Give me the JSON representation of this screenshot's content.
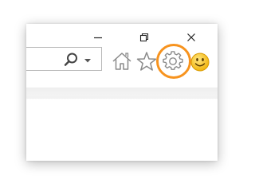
{
  "window_controls": {
    "minimize_icon": "minimize-icon",
    "maximize_icon": "restore-icon",
    "close_icon": "close-icon"
  },
  "toolbar": {
    "address_bar": {
      "value": "",
      "search_icon": "search-icon",
      "dropdown_icon": "chevron-down-icon"
    },
    "buttons": [
      {
        "name": "home",
        "icon": "home-icon"
      },
      {
        "name": "favorites",
        "icon": "star-icon"
      },
      {
        "name": "tools",
        "icon": "gear-icon",
        "highlighted": true
      },
      {
        "name": "feedback",
        "icon": "smiley-icon"
      }
    ]
  },
  "colors": {
    "highlight_ring": "#f7931e",
    "icon_gray": "#8a8a8a",
    "smiley_yellow": "#f6c21c"
  }
}
